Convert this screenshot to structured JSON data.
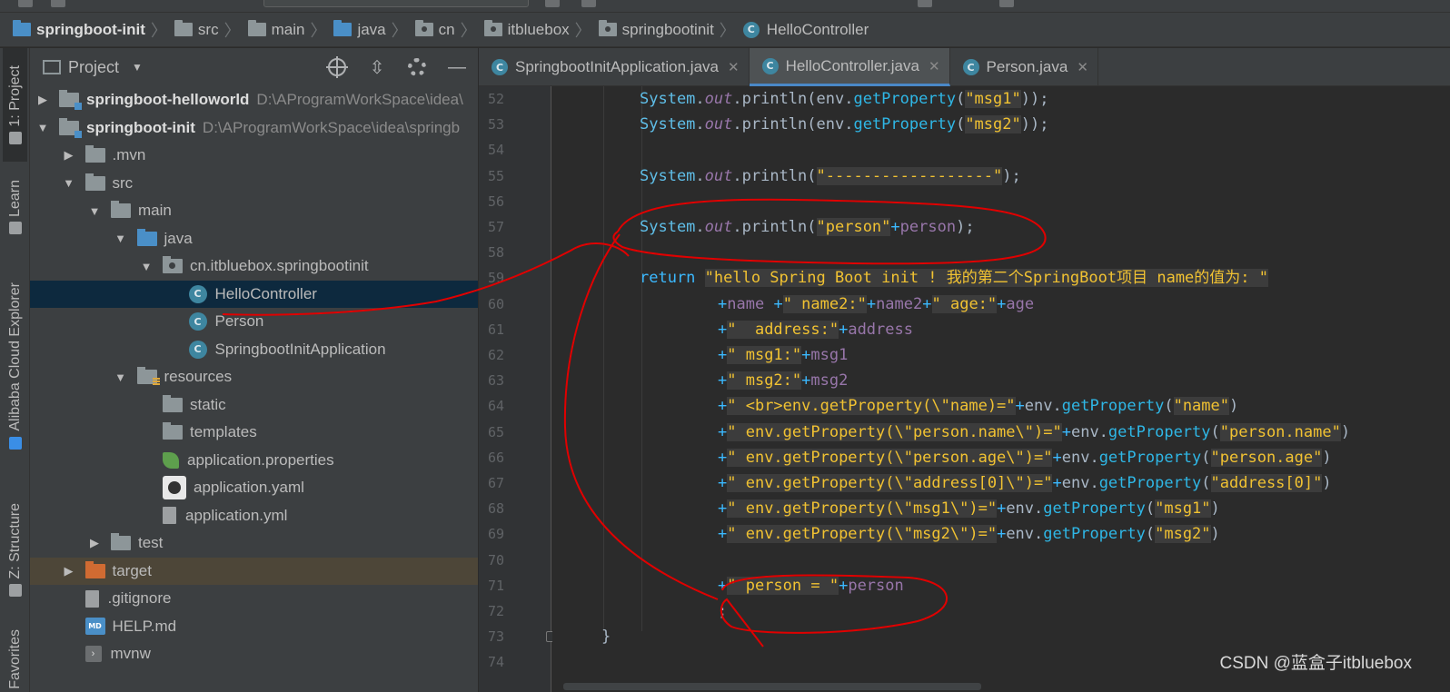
{
  "breadcrumb": [
    {
      "label": "springboot-init",
      "icon": "module-folder-icon",
      "bold": true
    },
    {
      "label": "src",
      "icon": "folder-icon"
    },
    {
      "label": "main",
      "icon": "folder-icon"
    },
    {
      "label": "java",
      "icon": "source-folder-icon"
    },
    {
      "label": "cn",
      "icon": "package-icon"
    },
    {
      "label": "itbluebox",
      "icon": "package-icon"
    },
    {
      "label": "springbootinit",
      "icon": "package-icon"
    },
    {
      "label": "HelloController",
      "icon": "class-icon"
    }
  ],
  "side_tabs": {
    "project": "1: Project",
    "learn": "Learn",
    "alibaba": "Alibaba Cloud Explorer",
    "structure": "Z: Structure",
    "favorites": "Favorites"
  },
  "project_panel": {
    "title": "Project",
    "tree": [
      {
        "label": "springboot-helloworld",
        "path": "D:\\AProgramWorkSpace\\idea\\",
        "bold": true,
        "depth": 0,
        "arrow": "right",
        "icon": "module"
      },
      {
        "label": "springboot-init",
        "path": "D:\\AProgramWorkSpace\\idea\\springb",
        "bold": true,
        "depth": 0,
        "arrow": "down",
        "icon": "module"
      },
      {
        "label": ".mvn",
        "depth": 1,
        "arrow": "right",
        "icon": "folder"
      },
      {
        "label": "src",
        "depth": 1,
        "arrow": "down",
        "icon": "folder"
      },
      {
        "label": "main",
        "depth": 2,
        "arrow": "down",
        "icon": "folder"
      },
      {
        "label": "java",
        "depth": 3,
        "arrow": "down",
        "icon": "source"
      },
      {
        "label": "cn.itbluebox.springbootinit",
        "depth": 4,
        "arrow": "down",
        "icon": "package"
      },
      {
        "label": "HelloController",
        "depth": 5,
        "arrow": "none",
        "icon": "class",
        "selected": true
      },
      {
        "label": "Person",
        "depth": 5,
        "arrow": "none",
        "icon": "class"
      },
      {
        "label": "SpringbootInitApplication",
        "depth": 5,
        "arrow": "none",
        "icon": "class"
      },
      {
        "label": "resources",
        "depth": 3,
        "arrow": "down",
        "icon": "resources"
      },
      {
        "label": "static",
        "depth": 4,
        "arrow": "none",
        "icon": "folder"
      },
      {
        "label": "templates",
        "depth": 4,
        "arrow": "none",
        "icon": "folder"
      },
      {
        "label": "application.properties",
        "depth": 4,
        "arrow": "none",
        "icon": "leaf"
      },
      {
        "label": "application.yaml",
        "depth": 4,
        "arrow": "none",
        "icon": "yaml"
      },
      {
        "label": "application.yml",
        "depth": 4,
        "arrow": "none",
        "icon": "file"
      },
      {
        "label": "test",
        "depth": 2,
        "arrow": "right",
        "icon": "folder"
      },
      {
        "label": "target",
        "depth": 1,
        "arrow": "right",
        "icon": "target",
        "excluded": true
      },
      {
        "label": ".gitignore",
        "depth": 1,
        "arrow": "none",
        "icon": "file"
      },
      {
        "label": "HELP.md",
        "depth": 1,
        "arrow": "none",
        "icon": "md"
      },
      {
        "label": "mvnw",
        "depth": 1,
        "arrow": "none",
        "icon": "exec"
      }
    ]
  },
  "editor_tabs": [
    {
      "label": "SpringbootInitApplication.java",
      "active": false
    },
    {
      "label": "HelloController.java",
      "active": true
    },
    {
      "label": "Person.java",
      "active": false
    }
  ],
  "line_numbers": [
    "52",
    "53",
    "54",
    "55",
    "56",
    "57",
    "58",
    "59",
    "60",
    "61",
    "62",
    "63",
    "64",
    "65",
    "66",
    "67",
    "68",
    "69",
    "70",
    "71",
    "72",
    "73",
    "74"
  ],
  "code_lines": [
    {
      "indent": 96,
      "tokens": [
        [
          "sys",
          "System"
        ],
        [
          "pl",
          "."
        ],
        [
          "out",
          "out"
        ],
        [
          "pl",
          ".println("
        ],
        [
          "pl",
          "env."
        ],
        [
          "get",
          "getProperty"
        ],
        [
          "pl",
          "("
        ],
        [
          "str",
          "\"msg1\""
        ],
        [
          "pl",
          "));"
        ]
      ]
    },
    {
      "indent": 96,
      "tokens": [
        [
          "sys",
          "System"
        ],
        [
          "pl",
          "."
        ],
        [
          "out",
          "out"
        ],
        [
          "pl",
          ".println("
        ],
        [
          "pl",
          "env."
        ],
        [
          "get",
          "getProperty"
        ],
        [
          "pl",
          "("
        ],
        [
          "str",
          "\"msg2\""
        ],
        [
          "pl",
          "));"
        ]
      ]
    },
    {
      "indent": 0,
      "tokens": []
    },
    {
      "indent": 96,
      "tokens": [
        [
          "sys",
          "System"
        ],
        [
          "pl",
          "."
        ],
        [
          "out",
          "out"
        ],
        [
          "pl",
          ".println("
        ],
        [
          "str",
          "\"------------------\""
        ],
        [
          "pl",
          ");"
        ]
      ]
    },
    {
      "indent": 0,
      "tokens": []
    },
    {
      "indent": 96,
      "tokens": [
        [
          "sys",
          "System"
        ],
        [
          "pl",
          "."
        ],
        [
          "out",
          "out"
        ],
        [
          "pl",
          ".println("
        ],
        [
          "str",
          "\"person\""
        ],
        [
          "op",
          "+"
        ],
        [
          "var",
          "person"
        ],
        [
          "pl",
          ");"
        ]
      ]
    },
    {
      "indent": 0,
      "tokens": []
    },
    {
      "indent": 96,
      "tokens": [
        [
          "kw",
          "return "
        ],
        [
          "str",
          "\"hello Spring Boot init ! 我的第二个SpringBoot项目 name的值为: \""
        ]
      ]
    },
    {
      "indent": 182,
      "tokens": [
        [
          "op",
          "+"
        ],
        [
          "var",
          "name "
        ],
        [
          "op",
          "+"
        ],
        [
          "str",
          "\" name2:\""
        ],
        [
          "op",
          "+"
        ],
        [
          "var",
          "name2"
        ],
        [
          "op",
          "+"
        ],
        [
          "str",
          "\" age:\""
        ],
        [
          "op",
          "+"
        ],
        [
          "var",
          "age"
        ]
      ]
    },
    {
      "indent": 182,
      "tokens": [
        [
          "op",
          "+"
        ],
        [
          "str",
          "\"  address:\""
        ],
        [
          "op",
          "+"
        ],
        [
          "var",
          "address"
        ]
      ]
    },
    {
      "indent": 182,
      "tokens": [
        [
          "op",
          "+"
        ],
        [
          "str",
          "\" msg1:\""
        ],
        [
          "op",
          "+"
        ],
        [
          "var",
          "msg1"
        ]
      ]
    },
    {
      "indent": 182,
      "tokens": [
        [
          "op",
          "+"
        ],
        [
          "str",
          "\" msg2:\""
        ],
        [
          "op",
          "+"
        ],
        [
          "var",
          "msg2"
        ]
      ]
    },
    {
      "indent": 182,
      "tokens": [
        [
          "op",
          "+"
        ],
        [
          "str",
          "\" <br>env.getProperty(\\\"name)=\""
        ],
        [
          "op",
          "+"
        ],
        [
          "pl",
          "env."
        ],
        [
          "get",
          "getProperty"
        ],
        [
          "pl",
          "("
        ],
        [
          "str",
          "\"name\""
        ],
        [
          "pl",
          ")"
        ]
      ]
    },
    {
      "indent": 182,
      "tokens": [
        [
          "op",
          "+"
        ],
        [
          "str",
          "\" env.getProperty(\\\"person.name\\\")=\""
        ],
        [
          "op",
          "+"
        ],
        [
          "pl",
          "env."
        ],
        [
          "get",
          "getProperty"
        ],
        [
          "pl",
          "("
        ],
        [
          "str",
          "\"person.name\""
        ],
        [
          "pl",
          ")"
        ]
      ]
    },
    {
      "indent": 182,
      "tokens": [
        [
          "op",
          "+"
        ],
        [
          "str",
          "\" env.getProperty(\\\"person.age\\\")=\""
        ],
        [
          "op",
          "+"
        ],
        [
          "pl",
          "env."
        ],
        [
          "get",
          "getProperty"
        ],
        [
          "pl",
          "("
        ],
        [
          "str",
          "\"person.age\""
        ],
        [
          "pl",
          ")"
        ]
      ]
    },
    {
      "indent": 182,
      "tokens": [
        [
          "op",
          "+"
        ],
        [
          "str",
          "\" env.getProperty(\\\"address[0]\\\")=\""
        ],
        [
          "op",
          "+"
        ],
        [
          "pl",
          "env."
        ],
        [
          "get",
          "getProperty"
        ],
        [
          "pl",
          "("
        ],
        [
          "str",
          "\"address[0]\""
        ],
        [
          "pl",
          ")"
        ]
      ]
    },
    {
      "indent": 182,
      "tokens": [
        [
          "op",
          "+"
        ],
        [
          "str",
          "\" env.getProperty(\\\"msg1\\\")=\""
        ],
        [
          "op",
          "+"
        ],
        [
          "pl",
          "env."
        ],
        [
          "get",
          "getProperty"
        ],
        [
          "pl",
          "("
        ],
        [
          "str",
          "\"msg1\""
        ],
        [
          "pl",
          ")"
        ]
      ]
    },
    {
      "indent": 182,
      "tokens": [
        [
          "op",
          "+"
        ],
        [
          "str",
          "\" env.getProperty(\\\"msg2\\\")=\""
        ],
        [
          "op",
          "+"
        ],
        [
          "pl",
          "env."
        ],
        [
          "get",
          "getProperty"
        ],
        [
          "pl",
          "("
        ],
        [
          "str",
          "\"msg2\""
        ],
        [
          "pl",
          ")"
        ]
      ]
    },
    {
      "indent": 0,
      "tokens": []
    },
    {
      "indent": 182,
      "tokens": [
        [
          "op",
          "+"
        ],
        [
          "str",
          "\" person = \""
        ],
        [
          "op",
          "+"
        ],
        [
          "var",
          "person"
        ]
      ]
    },
    {
      "indent": 182,
      "tokens": [
        [
          "pl",
          ";"
        ]
      ]
    },
    {
      "indent": 54,
      "tokens": [
        [
          "pl",
          "}"
        ]
      ]
    },
    {
      "indent": 0,
      "tokens": []
    }
  ],
  "watermark": "CSDN @蓝盒子itbluebox",
  "colors": {
    "accent": "#4a88c7",
    "selection": "#0d293e",
    "annotation": "#e00000"
  }
}
